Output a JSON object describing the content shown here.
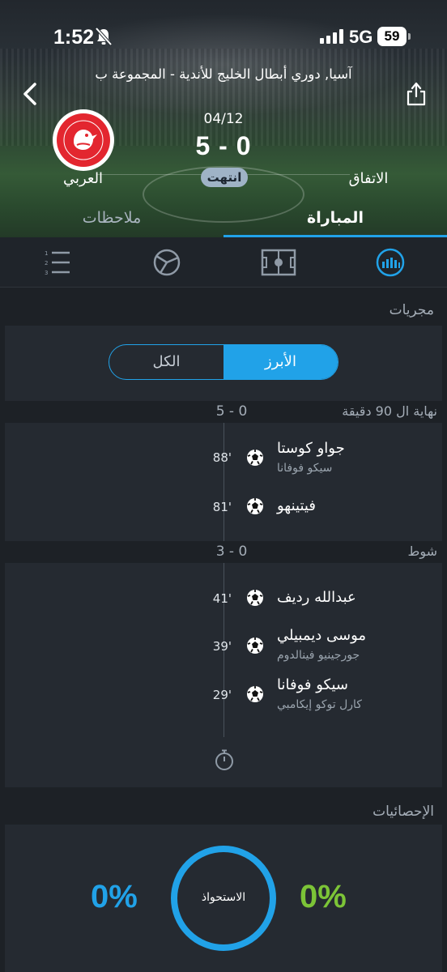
{
  "status_bar": {
    "time": "1:52",
    "network": "5G",
    "battery": "59"
  },
  "header": {
    "league": "آسيا, دوري أبطال الخليج للأندية - المجموعة ب",
    "date": "04/12",
    "score": "5 - 0",
    "match_status": "انتهت",
    "home_team": "الاتفاق",
    "away_team": "العربي",
    "tabs": {
      "match": "المباراة",
      "notes": "ملاحظات"
    }
  },
  "events_section": {
    "title": "مجريات",
    "filter": {
      "active": "الأبرز",
      "inactive": "الكل"
    },
    "periods": [
      {
        "label": "نهاية ال 90 دقيقة",
        "score": "5 - 0",
        "events": [
          {
            "minute": "88'",
            "player": "جواو كوستا",
            "assist": "سيكو فوفانا"
          },
          {
            "minute": "81'",
            "player": "فيتينهو",
            "assist": ""
          }
        ]
      },
      {
        "label": "شوط",
        "score": "3 - 0",
        "events": [
          {
            "minute": "41'",
            "player": "عبدالله رديف",
            "assist": ""
          },
          {
            "minute": "39'",
            "player": "موسى ديمبيلي",
            "assist": "جورجينيو فينالدوم"
          },
          {
            "minute": "29'",
            "player": "سيكو فوفانا",
            "assist": "كارل توكو إيكامبي"
          }
        ]
      }
    ]
  },
  "stats_section": {
    "title": "الإحصائيات",
    "possession_label": "الاستحواذ",
    "possession_left": "0%",
    "possession_right": "0%"
  },
  "colors": {
    "accent": "#21a2e8",
    "home_green": "#7cc437",
    "background": "#1d2126",
    "card": "#252a31"
  }
}
